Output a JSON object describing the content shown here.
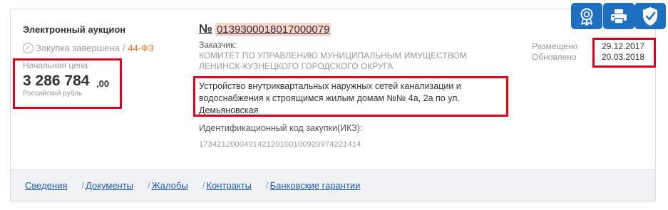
{
  "procedure": {
    "type": "Электронный аукцион",
    "status": "Закупка завершена",
    "status_separator": "/",
    "law": "44-ФЗ"
  },
  "price": {
    "label": "Начальная цена",
    "value": "3 286 784",
    "cents": ",00",
    "currency": "Российский рубль"
  },
  "number": {
    "sign": "№",
    "value": "0139300018017000079"
  },
  "customer": {
    "label": "Заказчик:",
    "name": "КОМИТЕТ ПО УПРАВЛЕНИЮ МУНИЦИПАЛЬНЫМ ИМУЩЕСТВОМ ЛЕНИНСК-КУЗНЕЦКОГО ГОРОДСКОГО ОКРУГА"
  },
  "object": {
    "text": "Устройство внутриквартальных наружных сетей канализации и водоснабжения к строящимся жилым домам №№ 4а, 2а по ул. Демьяновская"
  },
  "ikz": {
    "label": "Идентификационный код закупки(ИКЗ):",
    "value": "173421200040142120100100920974221414"
  },
  "dates": {
    "posted_label": "Размещено",
    "posted_value": "29.12.2017",
    "updated_label": "Обновлено",
    "updated_value": "20.03.2018"
  },
  "icons": {
    "award": "award-icon",
    "print": "print-icon",
    "shield": "shield-check-icon",
    "accent": "#1e6fbf"
  },
  "tabs": [
    {
      "label": "Сведения"
    },
    {
      "label": "Документы"
    },
    {
      "label": "Жалобы"
    },
    {
      "label": "Контракты"
    },
    {
      "label": "Банковские гарантии"
    }
  ],
  "tab_separator": "/"
}
